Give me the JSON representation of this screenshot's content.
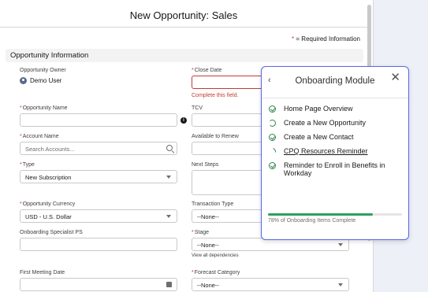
{
  "dialog": {
    "title": "New Opportunity: Sales",
    "required_note_star": "*",
    "required_note": " = Required Information",
    "section_title": "Opportunity Information"
  },
  "fields": {
    "owner_label": "Opportunity Owner",
    "owner_value": "Demo User",
    "close_date_label": "Close Date",
    "close_date_error": "Complete this field.",
    "opp_name_label": "Opportunity Name",
    "tcv_label": "TCV",
    "account_label": "Account Name",
    "account_placeholder": "Search Accounts...",
    "available_label": "Available to Renew",
    "type_label": "Type",
    "type_value": "New Subscription",
    "next_steps_label": "Next Steps",
    "currency_label": "Opportunity Currency",
    "currency_value": "USD - U.S. Dollar",
    "transaction_label": "Transaction Type",
    "transaction_value": "--None--",
    "specialist_label": "Onboarding Specialist PS",
    "stage_label": "Stage",
    "stage_value": "--None--",
    "stage_hint": "View all dependencies",
    "first_meeting_label": "First Meeting Date",
    "forecast_label": "Forecast Category",
    "forecast_value": "--None--",
    "info_glyph": "i"
  },
  "onboarding": {
    "title": "Onboarding Module",
    "back_glyph": "‹",
    "close_glyph": "✕",
    "items": [
      {
        "label": "Home Page Overview",
        "status": "complete"
      },
      {
        "label": "Create a New Opportunity",
        "status": "in-progress"
      },
      {
        "label": "Create a New Contact",
        "status": "complete"
      },
      {
        "label": "CPQ Resources Reminder",
        "status": "started"
      },
      {
        "label": "Reminder to Enroll in Benefits in Workday",
        "status": "complete"
      }
    ],
    "progress_percent": 78,
    "progress_text": "78% of Onboarding Items Complete"
  },
  "colors": {
    "accent": "#5867e8",
    "error": "#c23934",
    "success": "#2e844a"
  }
}
